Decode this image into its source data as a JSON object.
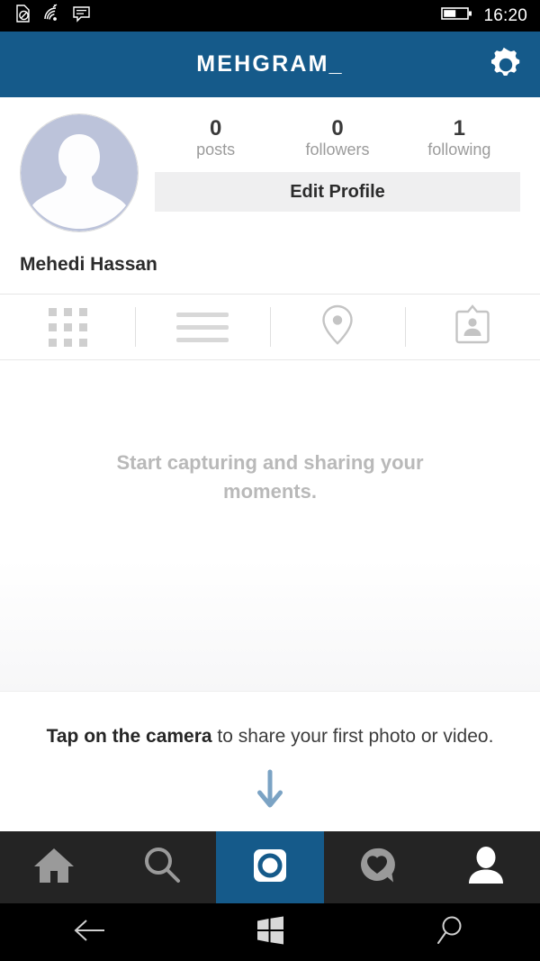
{
  "statusbar": {
    "icons": [
      "no-sim-icon",
      "wifi-icon",
      "message-icon"
    ],
    "battery": "battery-half-icon",
    "time": "16:20"
  },
  "appbar": {
    "title": "MEHGRAM_",
    "settings_icon": "gear-icon",
    "background_color": "#155a8a"
  },
  "profile": {
    "avatar": "default-avatar-placeholder",
    "stats": [
      {
        "value": "0",
        "label": "posts"
      },
      {
        "value": "0",
        "label": "followers"
      },
      {
        "value": "1",
        "label": "following"
      }
    ],
    "edit_button": "Edit Profile",
    "full_name": "Mehedi Hassan"
  },
  "tabs": [
    {
      "name": "grid-view",
      "icon": "grid-icon",
      "active": true
    },
    {
      "name": "list-view",
      "icon": "list-icon",
      "active": false
    },
    {
      "name": "map-view",
      "icon": "location-pin-icon",
      "active": false
    },
    {
      "name": "tagged-view",
      "icon": "tagged-photos-icon",
      "active": false
    }
  ],
  "content": {
    "empty_message": "Start capturing and sharing your moments."
  },
  "hint": {
    "bold_part": "Tap on the camera",
    "rest": " to share your first photo or video.",
    "arrow_icon": "arrow-down-icon",
    "arrow_color": "#7ba3c4"
  },
  "appnav": [
    {
      "name": "home",
      "icon": "home-icon",
      "active": false
    },
    {
      "name": "search",
      "icon": "search-icon",
      "active": false
    },
    {
      "name": "camera",
      "icon": "camera-icon",
      "active": true
    },
    {
      "name": "activity",
      "icon": "heart-bubble-icon",
      "active": false
    },
    {
      "name": "profile",
      "icon": "person-icon",
      "active": true
    }
  ],
  "sysnav": [
    {
      "name": "back",
      "icon": "back-arrow-icon"
    },
    {
      "name": "start",
      "icon": "windows-logo-icon"
    },
    {
      "name": "search",
      "icon": "search-icon"
    }
  ]
}
